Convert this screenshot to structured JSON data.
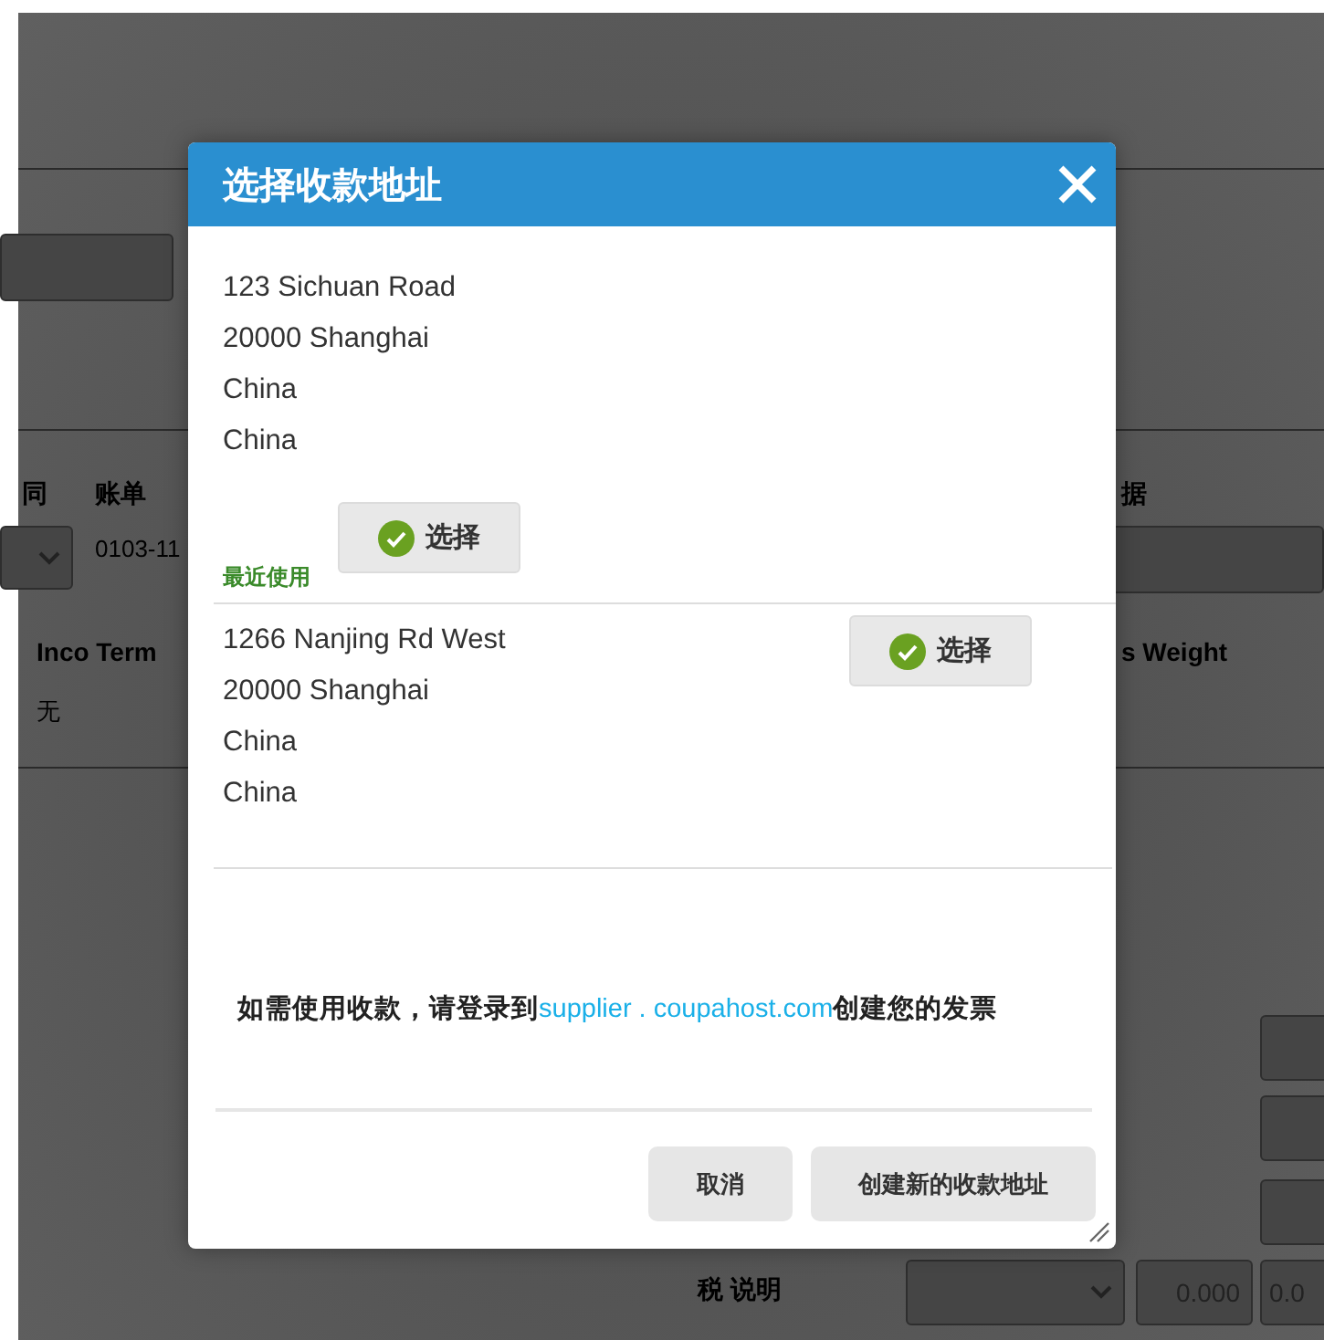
{
  "background": {
    "labels": [
      {
        "kind": "header",
        "text": "同"
      },
      {
        "kind": "header",
        "text": "账单"
      },
      {
        "kind": "value",
        "text": "0103-11"
      },
      {
        "kind": "header",
        "text": "Inco Term"
      },
      {
        "kind": "value",
        "text": "无"
      },
      {
        "kind": "header",
        "text": "据"
      },
      {
        "kind": "header",
        "text": "s Weight"
      },
      {
        "kind": "header",
        "text": "税 说明"
      }
    ],
    "amounts": [
      "0.000",
      "0.0"
    ]
  },
  "dialog": {
    "title": "选择收款地址",
    "addresses": [
      {
        "kind": "recent",
        "lines": [
          "123 Sichuan Road",
          "20000 Shanghai",
          "China",
          "China"
        ],
        "badge": "最近使用",
        "button": "选择"
      },
      {
        "kind": "plain",
        "lines": [
          "1266 Nanjing Rd West",
          "20000 Shanghai",
          "China",
          "China"
        ],
        "button": "选择"
      }
    ],
    "message": {
      "before": "如需使用收款，请登录到",
      "link": "supplier . coupahost.com",
      "after": "创建您的发票"
    },
    "buttons": [
      {
        "kind": "secondary",
        "label": "取消"
      },
      {
        "kind": "primary",
        "label": "创建新的收款地址"
      }
    ]
  }
}
